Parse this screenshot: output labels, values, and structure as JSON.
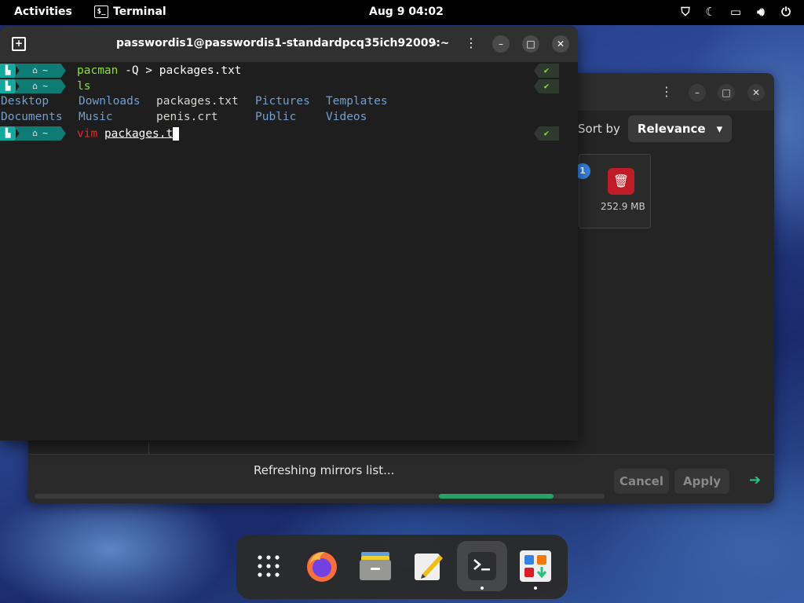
{
  "topbar": {
    "activities": "Activities",
    "app_name": "Terminal",
    "app_icon_text": "$_",
    "clock": "Aug 9  04:02"
  },
  "terminal": {
    "title": "passwordis1@passwordis1-standardpcq35ich92009:~",
    "prompt_home": "⌂ ~",
    "prompt_ok": "✔",
    "lines": [
      {
        "cmd": "pacman",
        "rest": " -Q > packages.txt"
      },
      {
        "cmd": "ls"
      },
      {
        "cmd": "vim",
        "arg": "packages.t"
      }
    ],
    "ls_output": {
      "row1": [
        "Desktop",
        "Downloads",
        "packages.txt",
        "Pictures",
        "Templates"
      ],
      "row2": [
        "Documents",
        "Music",
        "penis.crt",
        "Public",
        "Videos"
      ]
    }
  },
  "bg_window": {
    "sort_label": "Sort by",
    "sort_value": "Relevance",
    "badge": "1",
    "item_size": "252.9 MB",
    "status": "Refreshing mirrors list...",
    "cancel": "Cancel",
    "apply": "Apply",
    "progress": {
      "start": 0.71,
      "end": 0.91
    }
  },
  "dock": {
    "items": [
      "app-grid",
      "firefox",
      "files",
      "text-editor",
      "terminal",
      "software"
    ]
  }
}
